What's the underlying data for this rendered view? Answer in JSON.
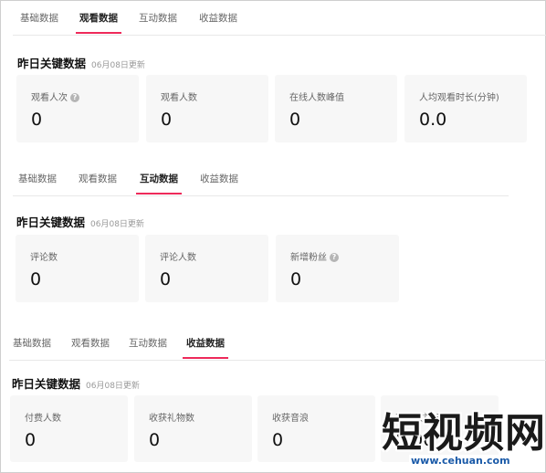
{
  "section1": {
    "tabs": [
      {
        "label": "基础数据"
      },
      {
        "label": "观看数据"
      },
      {
        "label": "互动数据"
      },
      {
        "label": "收益数据"
      }
    ],
    "active_tab": "观看数据",
    "title": "昨日关键数据",
    "date": "06月08日更新",
    "cards": [
      {
        "label": "观看人次",
        "value": "0",
        "help": true
      },
      {
        "label": "观看人数",
        "value": "0"
      },
      {
        "label": "在线人数峰值",
        "value": "0"
      },
      {
        "label": "人均观看时长(分钟)",
        "value": "0.0"
      }
    ]
  },
  "section2": {
    "tabs": [
      {
        "label": "基础数据"
      },
      {
        "label": "观看数据"
      },
      {
        "label": "互动数据"
      },
      {
        "label": "收益数据"
      }
    ],
    "active_tab": "互动数据",
    "title": "昨日关键数据",
    "date": "06月08日更新",
    "cards": [
      {
        "label": "评论数",
        "value": "0"
      },
      {
        "label": "评论人数",
        "value": "0"
      },
      {
        "label": "新增粉丝",
        "value": "0",
        "help": true
      }
    ]
  },
  "section3": {
    "tabs": [
      {
        "label": "基础数据"
      },
      {
        "label": "观看数据"
      },
      {
        "label": "互动数据"
      },
      {
        "label": "收益数据"
      }
    ],
    "active_tab": "收益数据",
    "title": "昨日关键数据",
    "date": "06月08日更新",
    "cards": [
      {
        "label": "付费人数",
        "value": "0"
      },
      {
        "label": "收获礼物数",
        "value": "0"
      },
      {
        "label": "收获音浪",
        "value": "0"
      },
      {
        "label": "直播收益(元)",
        "value": "0.00",
        "help": true
      }
    ]
  },
  "help_glyph": "?",
  "watermark": {
    "text": "短视频网",
    "url": "www.cehuan.com"
  },
  "colors": {
    "accent": "#ee2a5a",
    "card_bg": "#f7f7f7",
    "watermark_url": "#1a5aa8"
  }
}
